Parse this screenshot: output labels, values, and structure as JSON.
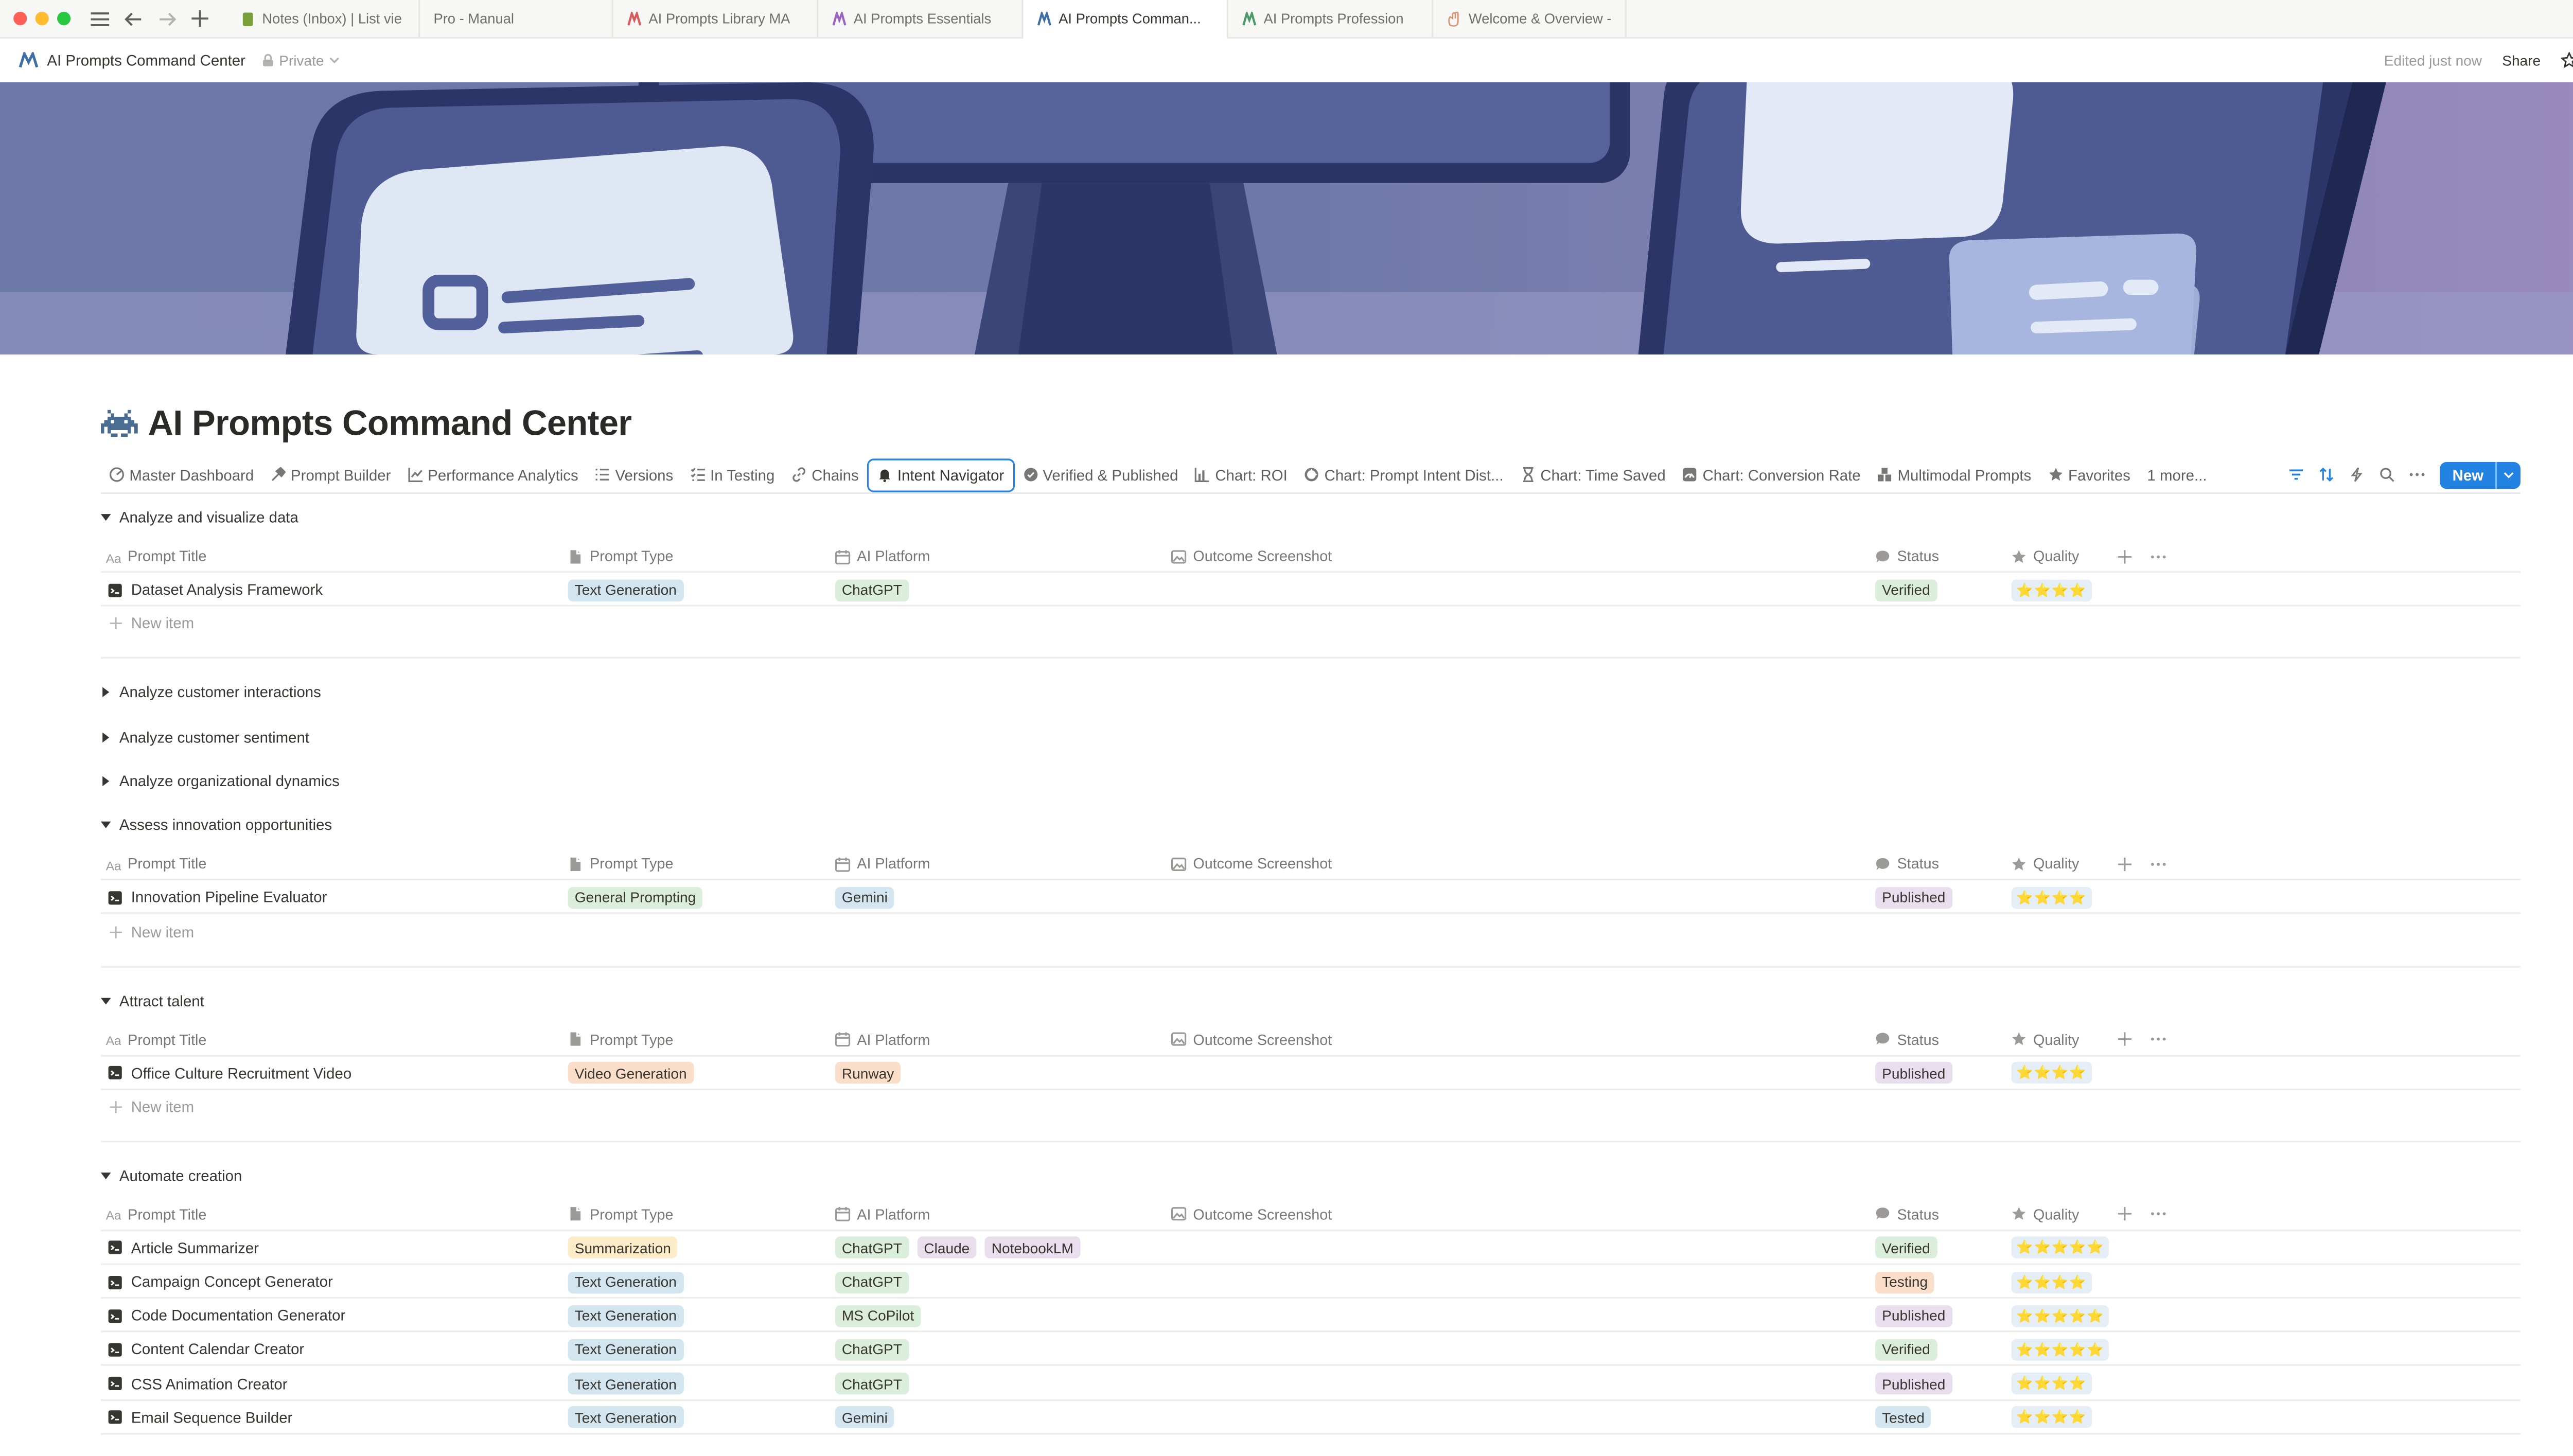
{
  "browser": {
    "tabs": [
      {
        "label": "Notes (Inbox) | List vie",
        "icon": "notes-book-icon",
        "color": "#7a9e3a",
        "active": false
      },
      {
        "label": "Pro - Manual",
        "icon": "",
        "color": "",
        "active": false
      },
      {
        "label": "AI Prompts Library MA",
        "icon": "ai-prompts-logo-icon",
        "color": "#d85a5a",
        "active": false
      },
      {
        "label": "AI Prompts Essentials",
        "icon": "ai-prompts-logo-icon",
        "color": "#9a63c6",
        "active": false
      },
      {
        "label": "AI Prompts Comman...",
        "icon": "ai-prompts-logo-icon",
        "color": "#3f6fa6",
        "active": true
      },
      {
        "label": "AI Prompts Profession",
        "icon": "ai-prompts-logo-icon",
        "color": "#4a9a6a",
        "active": false
      },
      {
        "label": "Welcome & Overview -",
        "icon": "welcome-hand-icon",
        "color": "#d89070",
        "active": false
      }
    ]
  },
  "page": {
    "breadcrumb": "AI Prompts Command Center",
    "privacy": "Private",
    "edited": "Edited just now",
    "share": "Share",
    "title": "AI Prompts Command Center",
    "accent": "#2383e2"
  },
  "views": [
    {
      "label": "Master Dashboard",
      "icon": "dashboard-icon",
      "active": false
    },
    {
      "label": "Prompt Builder",
      "icon": "hammer-icon",
      "active": false
    },
    {
      "label": "Performance Analytics",
      "icon": "line-chart-icon",
      "active": false
    },
    {
      "label": "Versions",
      "icon": "list-icon",
      "active": false
    },
    {
      "label": "In Testing",
      "icon": "checklist-icon",
      "active": false
    },
    {
      "label": "Chains",
      "icon": "link-icon",
      "active": false
    },
    {
      "label": "Intent Navigator",
      "icon": "bell-icon",
      "active": true
    },
    {
      "label": "Verified & Published",
      "icon": "verified-badge-icon",
      "active": false
    },
    {
      "label": "Chart: ROI",
      "icon": "bar-chart-icon",
      "active": false
    },
    {
      "label": "Chart: Prompt Intent Dist...",
      "icon": "donut-chart-icon",
      "active": false
    },
    {
      "label": "Chart: Time Saved",
      "icon": "hourglass-icon",
      "active": false
    },
    {
      "label": "Chart: Conversion Rate",
      "icon": "gauge-icon",
      "active": false
    },
    {
      "label": "Multimodal Prompts",
      "icon": "blocks-icon",
      "active": false
    },
    {
      "label": "Favorites",
      "icon": "star-icon",
      "active": false
    }
  ],
  "views_more": "1 more...",
  "new_button": "New",
  "columns": {
    "title": "Prompt Title",
    "type": "Prompt Type",
    "platform": "AI Platform",
    "outcome": "Outcome Screenshot",
    "status": "Status",
    "quality": "Quality"
  },
  "new_item_label": "New item",
  "tag_colors": {
    "Text Generation": "#d3e5ef",
    "General Prompting": "#dbeddb",
    "Video Generation": "#fadec9",
    "Summarization": "#fdecc8",
    "ChatGPT": "#dbeddb",
    "Gemini": "#d3e5ef",
    "Runway": "#fadec9",
    "Claude": "#e8deee",
    "NotebookLM": "#e8deee",
    "MS CoPilot": "#dbeddb",
    "Verified": "#dbeddb",
    "Published": "#e8deee",
    "Testing": "#fadec9",
    "Tested": "#d3e5ef"
  },
  "groups": [
    {
      "name": "Analyze and visualize data",
      "expanded": true,
      "rows": [
        {
          "title": "Dataset Analysis Framework",
          "type": "Text Generation",
          "platforms": [
            "ChatGPT"
          ],
          "status": "Verified",
          "quality": "⭐⭐⭐⭐"
        }
      ]
    },
    {
      "name": "Analyze customer interactions",
      "expanded": false,
      "rows": []
    },
    {
      "name": "Analyze customer sentiment",
      "expanded": false,
      "rows": []
    },
    {
      "name": "Analyze organizational dynamics",
      "expanded": false,
      "rows": []
    },
    {
      "name": "Assess innovation opportunities",
      "expanded": true,
      "rows": [
        {
          "title": "Innovation Pipeline Evaluator",
          "type": "General Prompting",
          "platforms": [
            "Gemini"
          ],
          "status": "Published",
          "quality": "⭐⭐⭐⭐"
        }
      ]
    },
    {
      "name": "Attract talent",
      "expanded": true,
      "rows": [
        {
          "title": "Office Culture Recruitment Video",
          "type": "Video Generation",
          "platforms": [
            "Runway"
          ],
          "status": "Published",
          "quality": "⭐⭐⭐⭐"
        }
      ]
    },
    {
      "name": "Automate creation",
      "expanded": true,
      "rows": [
        {
          "title": "Article Summarizer",
          "type": "Summarization",
          "platforms": [
            "ChatGPT",
            "Claude",
            "NotebookLM"
          ],
          "status": "Verified",
          "quality": "⭐⭐⭐⭐⭐"
        },
        {
          "title": "Campaign Concept Generator",
          "type": "Text Generation",
          "platforms": [
            "ChatGPT"
          ],
          "status": "Testing",
          "quality": "⭐⭐⭐⭐"
        },
        {
          "title": "Code Documentation Generator",
          "type": "Text Generation",
          "platforms": [
            "MS CoPilot"
          ],
          "status": "Published",
          "quality": "⭐⭐⭐⭐⭐"
        },
        {
          "title": "Content Calendar Creator",
          "type": "Text Generation",
          "platforms": [
            "ChatGPT"
          ],
          "status": "Verified",
          "quality": "⭐⭐⭐⭐⭐"
        },
        {
          "title": "CSS Animation Creator",
          "type": "Text Generation",
          "platforms": [
            "ChatGPT"
          ],
          "status": "Published",
          "quality": "⭐⭐⭐⭐"
        },
        {
          "title": "Email Sequence Builder",
          "type": "Text Generation",
          "platforms": [
            "Gemini"
          ],
          "status": "Tested",
          "quality": "⭐⭐⭐⭐"
        }
      ]
    }
  ]
}
